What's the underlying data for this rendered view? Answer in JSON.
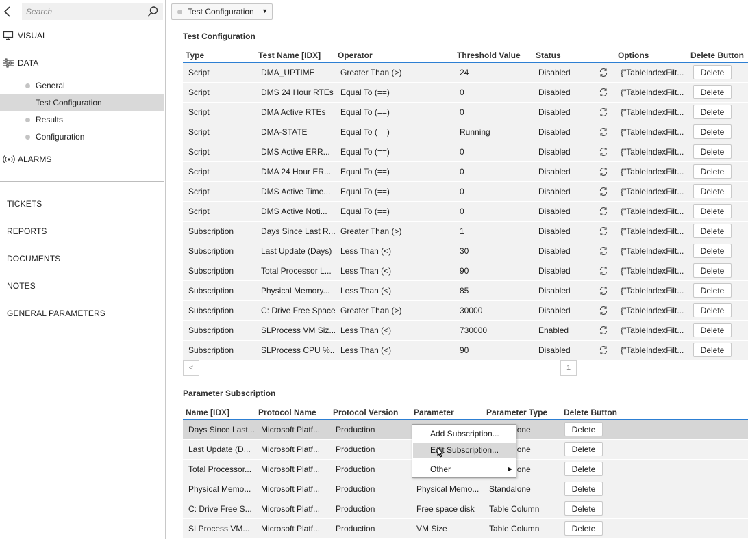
{
  "search": {
    "placeholder": "Search"
  },
  "sidebar": {
    "visual": "VISUAL",
    "data": "DATA",
    "data_items": [
      "General",
      "Test Configuration",
      "Results",
      "Configuration"
    ],
    "alarms": "ALARMS",
    "links": [
      "TICKETS",
      "REPORTS",
      "DOCUMENTS",
      "NOTES",
      "GENERAL PARAMETERS"
    ]
  },
  "dropdown": {
    "selected": "Test Configuration"
  },
  "test_config": {
    "title": "Test Configuration",
    "columns": [
      "Type",
      "Test Name [IDX]",
      "Operator",
      "Threshold Value",
      "Status",
      "Options",
      "Delete Button"
    ],
    "rows": [
      [
        "Script",
        "DMA_UPTIME",
        "Greater Than (>)",
        "24",
        "Disabled",
        "{\"TableIndexFilt...",
        "Delete"
      ],
      [
        "Script",
        "DMS 24 Hour RTEs",
        "Equal To (==)",
        "0",
        "Disabled",
        "{\"TableIndexFilt...",
        "Delete"
      ],
      [
        "Script",
        "DMA Active RTEs",
        "Equal To (==)",
        "0",
        "Disabled",
        "{\"TableIndexFilt...",
        "Delete"
      ],
      [
        "Script",
        "DMA-STATE",
        "Equal To (==)",
        "Running",
        "Disabled",
        "{\"TableIndexFilt...",
        "Delete"
      ],
      [
        "Script",
        "DMS Active ERR...",
        "Equal To (==)",
        "0",
        "Disabled",
        "{\"TableIndexFilt...",
        "Delete"
      ],
      [
        "Script",
        "DMA 24 Hour ER...",
        "Equal To (==)",
        "0",
        "Disabled",
        "{\"TableIndexFilt...",
        "Delete"
      ],
      [
        "Script",
        "DMS Active Time...",
        "Equal To (==)",
        "0",
        "Disabled",
        "{\"TableIndexFilt...",
        "Delete"
      ],
      [
        "Script",
        "DMS Active Noti...",
        "Equal To (==)",
        "0",
        "Disabled",
        "{\"TableIndexFilt...",
        "Delete"
      ],
      [
        "Subscription",
        "Days Since Last R...",
        "Greater Than (>)",
        "1",
        "Disabled",
        "{\"TableIndexFilt...",
        "Delete"
      ],
      [
        "Subscription",
        "Last Update (Days)",
        "Less Than (<)",
        "30",
        "Disabled",
        "{\"TableIndexFilt...",
        "Delete"
      ],
      [
        "Subscription",
        "Total Processor L...",
        "Less Than (<)",
        "90",
        "Disabled",
        "{\"TableIndexFilt...",
        "Delete"
      ],
      [
        "Subscription",
        "Physical Memory...",
        "Less Than (<)",
        "85",
        "Disabled",
        "{\"TableIndexFilt...",
        "Delete"
      ],
      [
        "Subscription",
        "C: Drive Free Space",
        "Greater Than (>)",
        "30000",
        "Disabled",
        "{\"TableIndexFilt...",
        "Delete"
      ],
      [
        "Subscription",
        "SLProcess VM Siz...",
        "Less Than (<)",
        "730000",
        "Enabled",
        "{\"TableIndexFilt...",
        "Delete"
      ],
      [
        "Subscription",
        "SLProcess CPU %...",
        "Less Than (<)",
        "90",
        "Disabled",
        "{\"TableIndexFilt...",
        "Delete"
      ]
    ],
    "pager": {
      "prev": "<",
      "page": "1"
    }
  },
  "param_sub": {
    "title": "Parameter Subscription",
    "columns": [
      "Name [IDX]",
      "Protocol Name",
      "Protocol Version",
      "Parameter",
      "Parameter Type",
      "Delete Button"
    ],
    "rows": [
      [
        "Days Since Last...",
        "Microsoft Platf...",
        "Production",
        "",
        "Standalone",
        "Delete"
      ],
      [
        "Last Update (D...",
        "Microsoft Platf...",
        "Production",
        "",
        "Standalone",
        "Delete"
      ],
      [
        "Total Processor...",
        "Microsoft Platf...",
        "Production",
        "",
        "Standalone",
        "Delete"
      ],
      [
        "Physical Memo...",
        "Microsoft Platf...",
        "Production",
        "Physical Memo...",
        "Standalone",
        "Delete"
      ],
      [
        "C: Drive Free S...",
        "Microsoft Platf...",
        "Production",
        "Free space disk",
        "Table Column",
        "Delete"
      ],
      [
        "SLProcess VM...",
        "Microsoft Platf...",
        "Production",
        "VM Size",
        "Table Column",
        "Delete"
      ]
    ]
  },
  "context_menu": {
    "items": [
      "Add Subscription...",
      "Edit Subscription...",
      "Other"
    ],
    "hovered": "Edit Subscription..."
  }
}
